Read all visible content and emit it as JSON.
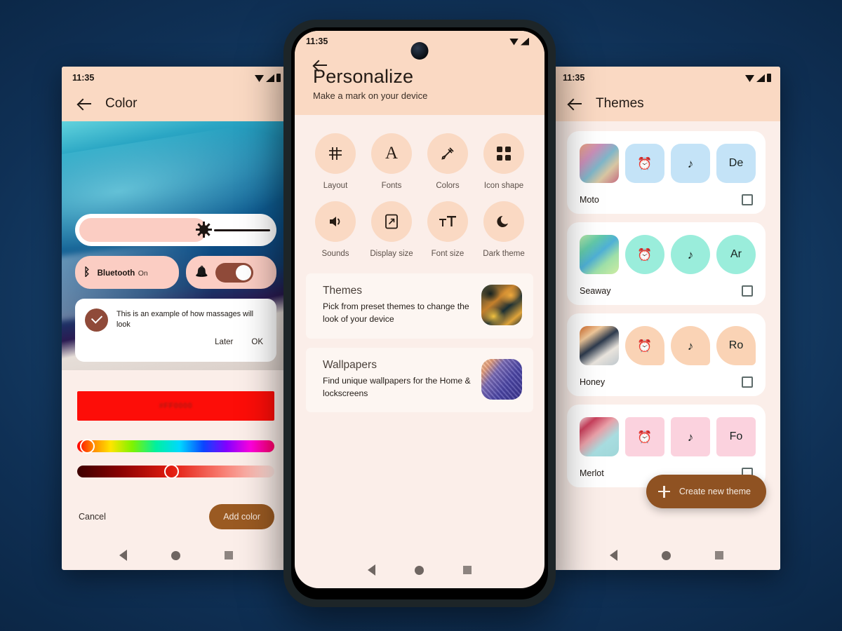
{
  "background": {
    "color_dark": "#0a2340",
    "color_light": "#1d5080"
  },
  "left_phone": {
    "statusbar": {
      "time": "11:35",
      "wifi": "wifi-icon",
      "signal": "signal-icon",
      "battery": "battery-icon"
    },
    "appbar": {
      "back": "back-arrow-icon",
      "title": "Color"
    },
    "preview": {
      "brightness": {
        "name": "brightness-slider",
        "icon": "brightness-icon"
      },
      "bluetooth_tile": {
        "label": "Bluetooth",
        "state": "On",
        "icon": "bluetooth-icon"
      },
      "notification_tile": {
        "icon": "bell-icon",
        "toggle_state": "on"
      },
      "message_card": {
        "text": "This is an example of how massages will look",
        "action_secondary": "Later",
        "action_primary": "OK",
        "avatar_icon": "check-icon"
      }
    },
    "picker": {
      "swatch_hex": "#FF0000",
      "swatch_color": "#fd0d08",
      "hue_slider": {
        "name": "hue-slider",
        "knob_percent": 2
      },
      "lightness_slider": {
        "name": "lightness-slider",
        "knob_percent": 47
      },
      "cancel_label": "Cancel",
      "add_label": "Add color"
    },
    "navbar": {
      "back": "nav-back-icon",
      "home": "nav-home-icon",
      "recents": "nav-recents-icon"
    }
  },
  "center_phone": {
    "statusbar": {
      "time": "11:35"
    },
    "header": {
      "back": "back-arrow-icon",
      "title": "Personalize",
      "subtitle": "Make a mark on your device"
    },
    "grid": [
      {
        "label": "Layout",
        "icon": "grid-icon"
      },
      {
        "label": "Fonts",
        "icon": "letter-a-icon"
      },
      {
        "label": "Colors",
        "icon": "eyedropper-icon"
      },
      {
        "label": "Icon shape",
        "icon": "four-squares-icon"
      },
      {
        "label": "Sounds",
        "icon": "speaker-icon"
      },
      {
        "label": "Display size",
        "icon": "display-size-icon"
      },
      {
        "label": "Font size",
        "icon": "font-size-icon"
      },
      {
        "label": "Dark theme",
        "icon": "moon-icon"
      }
    ],
    "cards": [
      {
        "title": "Themes",
        "desc": "Pick from preset themes to change the look of your device",
        "thumb": "themes-thumbnail"
      },
      {
        "title": "Wallpapers",
        "desc": "Find unique wallpapers for the Home & lockscreens",
        "thumb": "wallpapers-thumbnail"
      }
    ],
    "navbar": {
      "back": "nav-back-icon",
      "home": "nav-home-icon",
      "recents": "nav-recents-icon"
    }
  },
  "right_phone": {
    "statusbar": {
      "time": "11:35"
    },
    "appbar": {
      "back": "back-arrow-icon",
      "title": "Themes"
    },
    "themes": [
      {
        "name": "Moto",
        "accent": "#c4e3f7",
        "shape": "shape-rounded",
        "font_sample": "De",
        "checked": false
      },
      {
        "name": "Seaway",
        "accent": "#9aeddb",
        "shape": "shape-circle",
        "font_sample": "Ar",
        "checked": false
      },
      {
        "name": "Honey",
        "accent": "#fad3b5",
        "shape": "shape-teardrop",
        "font_sample": "Ro",
        "checked": false
      },
      {
        "name": "Merlot",
        "accent": "#fbd2de",
        "shape": "shape-square",
        "font_sample": "Fo",
        "checked": false
      }
    ],
    "theme_icon_names": {
      "alarm": "alarm-clock-icon",
      "music": "music-note-icon",
      "font": "font-sample-label"
    },
    "fab": {
      "label": "Create new theme",
      "icon": "plus-icon",
      "color": "#8f5222"
    },
    "navbar": {
      "back": "nav-back-icon",
      "home": "nav-home-icon",
      "recents": "nav-recents-icon"
    }
  }
}
